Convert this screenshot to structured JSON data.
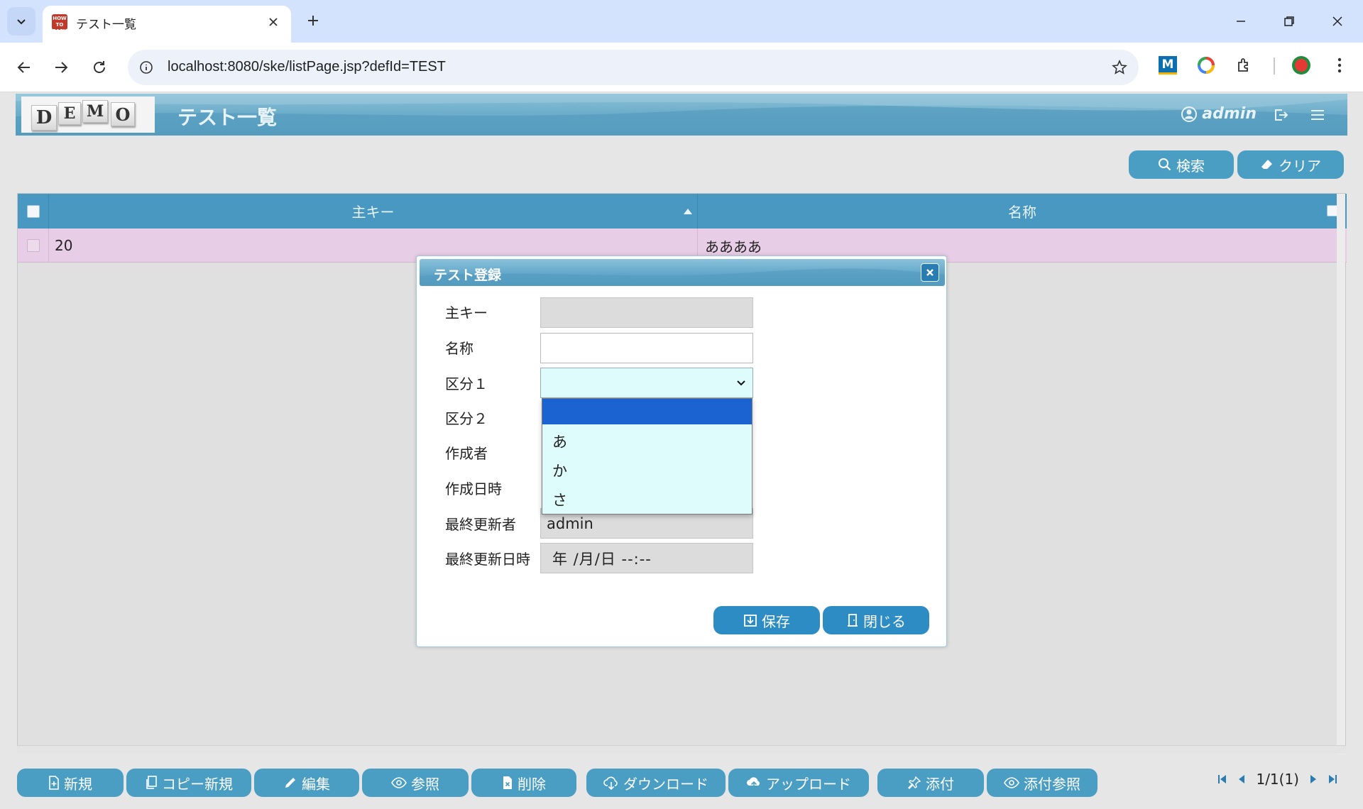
{
  "browser": {
    "tab_title": "テスト一覧",
    "favicon_text": "HOW TO EASY",
    "url": "localhost:8080/ske/listPage.jsp?defId=TEST",
    "extension_m_label": "M"
  },
  "header": {
    "logo_letters": [
      "D",
      "E",
      "M",
      "O"
    ],
    "title": "テスト一覧",
    "user": "admin"
  },
  "actions": {
    "search": "検索",
    "clear": "クリア"
  },
  "grid": {
    "columns": [
      {
        "label": "主キー",
        "sort": "asc"
      },
      {
        "label": "名称"
      }
    ],
    "rows": [
      {
        "key": "20",
        "name": "ああああ"
      }
    ]
  },
  "dialog": {
    "title": "テスト登録",
    "fields": [
      {
        "label": "主キー",
        "value": "",
        "state": "disabled"
      },
      {
        "label": "名称",
        "value": "",
        "state": "editable"
      },
      {
        "label": "区分１",
        "value": "",
        "state": "select-open"
      },
      {
        "label": "区分２",
        "value": ""
      },
      {
        "label": "作成者",
        "value": ""
      },
      {
        "label": "作成日時",
        "value": ""
      },
      {
        "label": "最終更新者",
        "value": "admin",
        "state": "disabled"
      },
      {
        "label": "最終更新日時",
        "value": "年 /月/日  --:--",
        "state": "disabled"
      }
    ],
    "dropdown_options": [
      "",
      "あ",
      "か",
      "さ"
    ],
    "save": "保存",
    "close": "閉じる"
  },
  "bottom_toolbar": {
    "buttons": [
      "新規",
      "コピー新規",
      "編集",
      "参照",
      "削除",
      "ダウンロード",
      "アップロード",
      "添付",
      "添付参照"
    ],
    "pager": "1/1(1)"
  },
  "colors": {
    "header_blue": "#5ea2c2",
    "grid_header": "#4998c2",
    "row_highlight": "#e8cde6",
    "select_bg": "#dffcfd",
    "dropdown_selected": "#1b63d1"
  }
}
